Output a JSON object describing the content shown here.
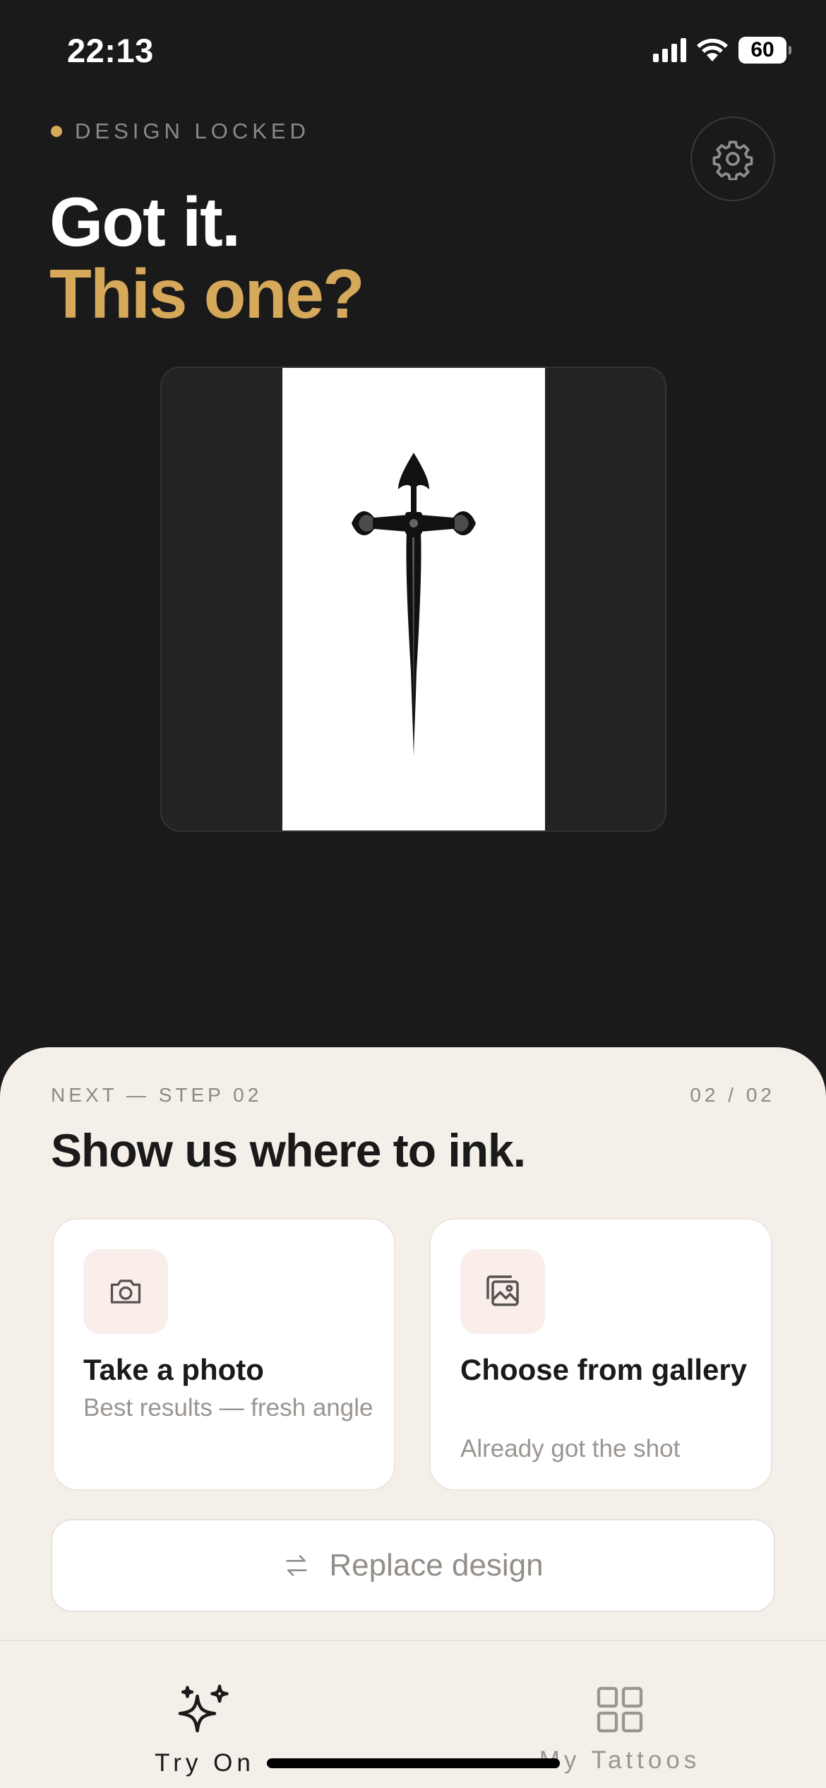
{
  "status_bar": {
    "time": "22:13",
    "battery": "60"
  },
  "header": {
    "badge": "DESIGN LOCKED",
    "title_line1": "Got it.",
    "title_line2": "This one?"
  },
  "sheet": {
    "step_label": "NEXT — STEP 02",
    "step_count": "02 / 02",
    "title": "Show us where to ink.",
    "options": [
      {
        "title": "Take a photo",
        "subtitle": "Best results — fresh angle",
        "icon": "camera-icon"
      },
      {
        "title": "Choose from gallery",
        "subtitle": "Already got the shot",
        "icon": "gallery-icon"
      }
    ],
    "replace_label": "Replace design"
  },
  "tab_bar": {
    "tabs": [
      {
        "label": "Try On",
        "icon": "sparkle-icon",
        "active": true
      },
      {
        "label": "My Tattoos",
        "icon": "grid-icon",
        "active": false
      }
    ]
  },
  "colors": {
    "accent": "#d6a85a",
    "background": "#1b1a1b",
    "sheet": "#f4efe9"
  }
}
